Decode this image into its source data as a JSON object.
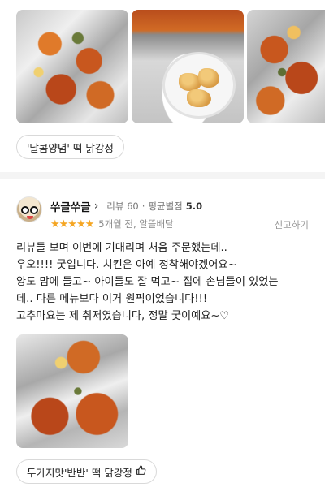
{
  "photos": [
    {
      "name": "review-photo-1"
    },
    {
      "name": "review-photo-2"
    },
    {
      "name": "review-photo-3"
    }
  ],
  "menu_chip_1": {
    "label": "'달콤양념' 떡 닭강정"
  },
  "review": {
    "user_name": "쑤글쑤글",
    "chevron": "›",
    "review_count": "리뷰 60",
    "avg_rating_label": "평균별점",
    "avg_rating_value": "5.0",
    "stars": "★★★★★",
    "meta": "5개월 전, 알뜰배달",
    "report_label": "신고하기",
    "text_lines": [
      "리뷰들 보며 이번에 기대리며 처음 주문했는데..",
      "우오!!!! 굿입니다. 치킨은 아예 정착해야겠어요~",
      "양도 맘에 들고~ 아이들도 잘 먹고~ 집에 손님들이 있었는",
      "데.. 다른 메뉴보다 이거 원픽이었습니다!!!",
      "고추마요는 제 취저였습니다, 정말 굿이예요~♡"
    ]
  },
  "menu_chip_2": {
    "label": "두가지맛'반반' 떡 닭강정",
    "icon": "thumbs-up-icon"
  },
  "colors": {
    "star": "#f5a623",
    "divider": "#f4f4f4"
  }
}
